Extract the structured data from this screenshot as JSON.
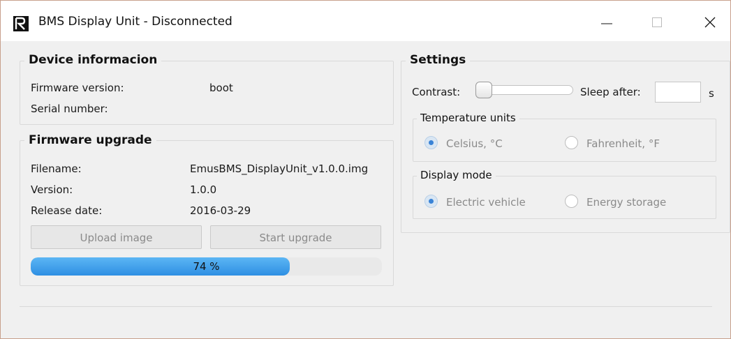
{
  "window": {
    "title": "BMS Display Unit - Disconnected",
    "colors": {
      "titlebar": "#ffffff",
      "background": "#f0f0f0",
      "progress": "#3d9ae8"
    }
  },
  "device_info": {
    "title": "Device informacion",
    "firmware_label": "Firmware version:",
    "firmware_value": "boot",
    "serial_label": "Serial number:",
    "serial_value": ""
  },
  "firmware_upgrade": {
    "title": "Firmware upgrade",
    "filename_label": "Filename:",
    "filename_value": "EmusBMS_DisplayUnit_v1.0.0.img",
    "version_label": "Version:",
    "version_value": "1.0.0",
    "release_label": "Release date:",
    "release_value": "2016-03-29",
    "upload_button": "Upload image",
    "start_button": "Start upgrade",
    "progress_percent": 74,
    "progress_text": "74 %"
  },
  "settings": {
    "title": "Settings",
    "contrast_label": "Contrast:",
    "contrast_level": 0,
    "sleep_label": "Sleep after:",
    "sleep_value": "",
    "sleep_unit": "s",
    "temperature": {
      "title": "Temperature units",
      "options": [
        "Celsius, °C",
        "Fahrenheit, °F"
      ],
      "selected": "Celsius, °C"
    },
    "display_mode": {
      "title": "Display mode",
      "options": [
        "Electric vehicle",
        "Energy storage"
      ],
      "selected": "Electric vehicle"
    }
  }
}
